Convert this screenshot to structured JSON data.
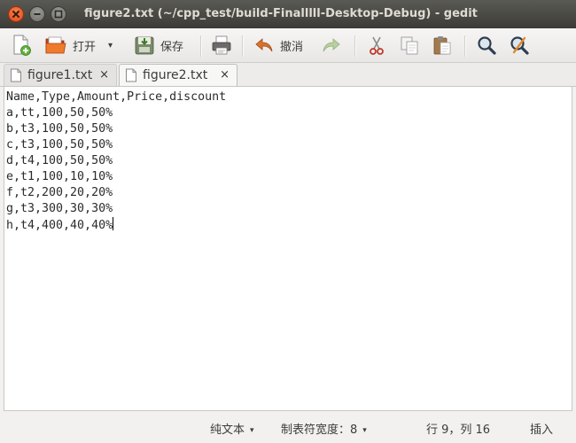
{
  "window": {
    "title": "figure2.txt (~/cpp_test/build-Finalllll-Desktop-Debug) - gedit"
  },
  "toolbar": {
    "open_label": "打开",
    "open_dropdown": "▾",
    "save_label": "保存",
    "undo_label": "撤消"
  },
  "tabs": [
    {
      "label": "figure1.txt",
      "close": "×",
      "active": false
    },
    {
      "label": "figure2.txt",
      "close": "×",
      "active": true
    }
  ],
  "document": {
    "lines": [
      "Name,Type,Amount,Price,discount",
      "a,tt,100,50,50%",
      "b,t3,100,50,50%",
      "c,t3,100,50,50%",
      "d,t4,100,50,50%",
      "e,t1,100,10,10%",
      "f,t2,200,20,20%",
      "g,t3,300,30,30%",
      "h,t4,400,40,40%"
    ]
  },
  "statusbar": {
    "syntax": "纯文本",
    "tab_width": "制表符宽度：8",
    "position": "行 9，列 16",
    "mode": "插入",
    "dropdown_arrow": "▾"
  }
}
